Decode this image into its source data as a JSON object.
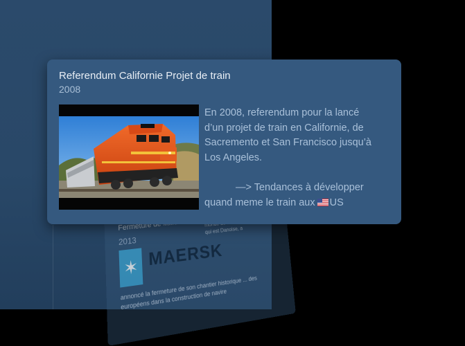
{
  "background_card": {
    "title": "Fermeture de",
    "title_small": "Maersk",
    "year": "2013",
    "logo_text": "MAERSK",
    "side_text": "L'une des plus grande flotte au monde de chantier naval, Maersk qui est Danoise, a",
    "body_text": "annoncé la fermeture de son chantier historique ... des européens dans la construction de navire"
  },
  "card": {
    "title": "Referendum Californie Projet de train",
    "year": "2008",
    "paragraph1_line1": "En 2008, referendum pour la lancé",
    "paragraph1_line2": "d’un projet de train en Californie, de",
    "paragraph1_line3": "Sacremento et San Francisco jusqu’à",
    "paragraph1_line4": "Los Angeles.",
    "paragraph2_line1": "—> Tendances à développer",
    "paragraph2_line2_before": "quand meme le train aux",
    "paragraph2_line2_after": "US"
  },
  "icons": {
    "photo": "train-photo",
    "flag": "us-flag-icon",
    "logo": "maersk-star-logo-icon"
  },
  "colors": {
    "stage": "#294868",
    "card": "#35597f",
    "text_light": "#a9c0d9",
    "locomotive": "#e8541c"
  }
}
